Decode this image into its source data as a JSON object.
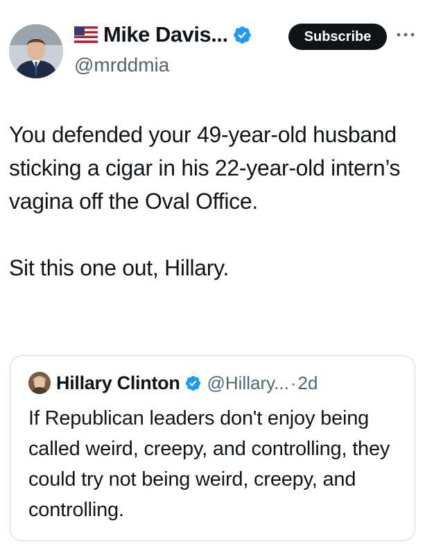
{
  "author": {
    "flag": "us-flag-icon",
    "display_name": "Mike Davis...",
    "handle": "@mrddmia",
    "verified": true
  },
  "actions": {
    "subscribe_label": "Subscribe",
    "more_icon": "more-icon"
  },
  "tweet": {
    "paragraph_1": "You defended your 49-year-old husband sticking a cigar in his 22-year-old intern’s vagina off the Oval Office.",
    "paragraph_2": "Sit this one out, Hillary."
  },
  "quote": {
    "display_name": "Hillary Clinton",
    "handle": "@Hillary...",
    "separator": "·",
    "time": "2d",
    "verified": true,
    "text": "If Republican leaders don't enjoy being called weird, creepy, and controlling, they could try not being weird, creepy, and controlling."
  },
  "colors": {
    "verified_blue": "#1d9bf0",
    "text_primary": "#0f1419",
    "text_secondary": "#536471",
    "border": "#cfd9de",
    "subscribe_bg": "#0f1419"
  }
}
